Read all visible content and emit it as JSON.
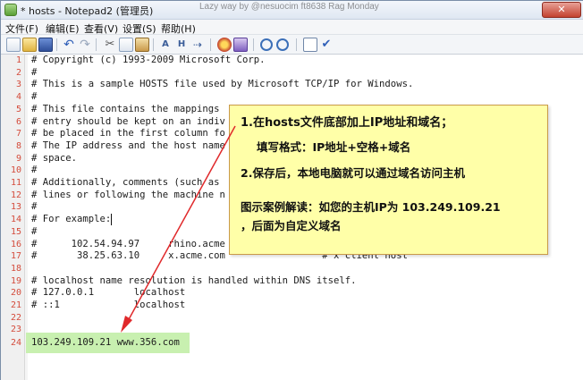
{
  "window": {
    "title": "* hosts - Notepad2 (管理员)",
    "overlay_text": "Lazy way by @nesuocim ft8638 Rag Monday",
    "close_label": "✕"
  },
  "menu": [
    "文件(F)",
    "编辑(E)",
    "查看(V)",
    "设置(S)",
    "帮助(H)"
  ],
  "toolbar_icons": [
    "new-file-icon",
    "open-file-icon",
    "save-icon",
    "undo-icon",
    "redo-icon",
    "cut-icon",
    "copy-icon",
    "paste-icon",
    "find-icon",
    "replace-icon",
    "goto-icon",
    "scheme-icon",
    "zoom-in-icon",
    "zoom-out-icon",
    "view-icon",
    "settings-icon"
  ],
  "editor": {
    "lines": [
      {
        "num": "1",
        "text": "# Copyright (c) 1993-2009 Microsoft Corp."
      },
      {
        "num": "2",
        "text": "#"
      },
      {
        "num": "3",
        "text": "# This is a sample HOSTS file used by Microsoft TCP/IP for Windows."
      },
      {
        "num": "4",
        "text": "#"
      },
      {
        "num": "5",
        "text": "# This file contains the mappings"
      },
      {
        "num": "6",
        "text": "# entry should be kept on an indiv"
      },
      {
        "num": "7",
        "text": "# be placed in the first column fo"
      },
      {
        "num": "8",
        "text": "# The IP address and the host name"
      },
      {
        "num": "9",
        "text": "# space."
      },
      {
        "num": "10",
        "text": "#"
      },
      {
        "num": "11",
        "text": "# Additionally, comments (such as"
      },
      {
        "num": "12",
        "text": "# lines or following the machine n"
      },
      {
        "num": "13",
        "text": "#"
      },
      {
        "num": "14",
        "text": "# For example:"
      },
      {
        "num": "15",
        "text": "#"
      },
      {
        "num": "16",
        "text": "#      102.54.94.97     rhino.acme"
      },
      {
        "num": "17",
        "text": "#       38.25.63.10     x.acme.com                 # x client host"
      },
      {
        "num": "18",
        "text": ""
      },
      {
        "num": "19",
        "text": "# localhost name resolution is handled within DNS itself."
      },
      {
        "num": "20",
        "text": "# 127.0.0.1       localhost"
      },
      {
        "num": "21",
        "text": "# ::1             localhost"
      },
      {
        "num": "22",
        "text": ""
      },
      {
        "num": "23",
        "text": ""
      },
      {
        "num": "24",
        "text": "103.249.109.21 www.356.com"
      }
    ]
  },
  "annotation": {
    "step1": "1.在hosts文件底部加上IP地址和域名；",
    "format": "填写格式：IP地址+空格+域名",
    "step2": "2.保存后，本地电脑就可以通过域名访问主机",
    "example_line1": "图示案例解读：如您的主机IP为 103.249.109.21",
    "example_line2": "，后面为自定义域名"
  },
  "colors": {
    "annotation_bg": "#ffffa8",
    "highlight_bg": "#c8f0b0",
    "arrow": "#e0292b",
    "line_numbers": "#d44c3c"
  }
}
